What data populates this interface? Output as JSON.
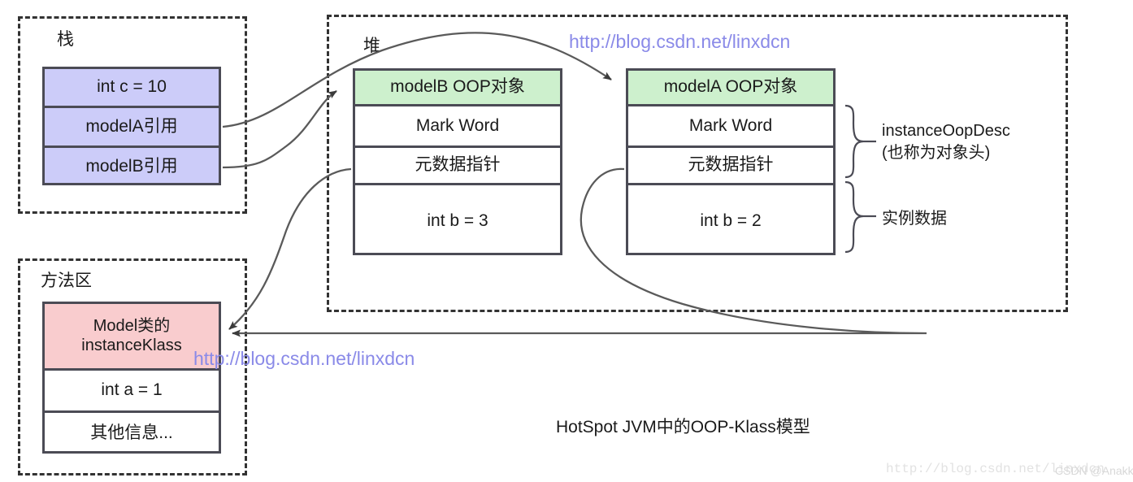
{
  "diagram": {
    "caption": "HotSpot JVM中的OOP-Klass模型",
    "colors": {
      "stack_fill": "#ccccf9",
      "heap_header_fill": "#cdf0cd",
      "method_area_fill": "#f9ccce",
      "border": "#4b4b55",
      "region_border": "#333333",
      "watermark": "#8a8ae8"
    },
    "regions": [
      {
        "name": "stack",
        "label": "栈"
      },
      {
        "name": "heap",
        "label": "堆"
      },
      {
        "name": "method-area",
        "label": "方法区"
      }
    ],
    "stack_frame": {
      "rows": [
        "int c = 10",
        "modelA引用",
        "modelB引用"
      ]
    },
    "heap_objects": [
      {
        "name": "modelB",
        "header": "modelB OOP对象",
        "rows": [
          "Mark Word",
          "元数据指针",
          "int b = 3"
        ]
      },
      {
        "name": "modelA",
        "header": "modelA OOP对象",
        "rows": [
          "Mark Word",
          "元数据指针",
          "int b = 2"
        ]
      }
    ],
    "brace_annotations": [
      {
        "name": "instance-oop-desc",
        "line1": "instanceOopDesc",
        "line2": "(也称为对象头)"
      },
      {
        "name": "instance-data",
        "line1": "实例数据",
        "line2": ""
      }
    ],
    "method_area_table": {
      "header_line1": "Model类的",
      "header_line2": "instanceKlass",
      "rows": [
        "int a = 1",
        "其他信息..."
      ]
    },
    "watermarks": [
      {
        "name": "watermark-top",
        "text": "http://blog.csdn.net/linxdcn"
      },
      {
        "name": "watermark-middle",
        "text": "http://blog.csdn.net/linxdcn"
      },
      {
        "name": "watermark-bottom-url",
        "text": "http://blog.csdn.net/linxdcn"
      },
      {
        "name": "watermark-bottom-csdn",
        "text": "CSDN @Anakki"
      }
    ]
  }
}
